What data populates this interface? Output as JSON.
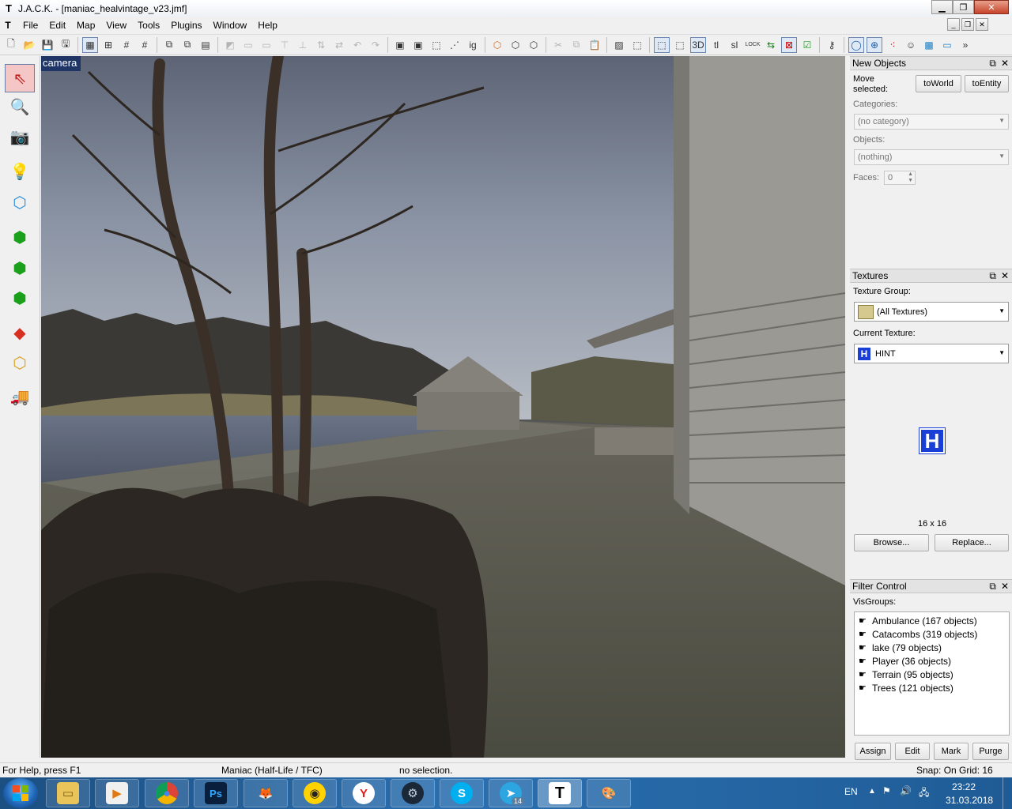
{
  "window": {
    "title": "J.A.C.K. - [maniac_healvintage_v23.jmf]",
    "minimize": "▁",
    "maximize": "❐",
    "close": "✕"
  },
  "menu": [
    "File",
    "Edit",
    "Map",
    "View",
    "Tools",
    "Plugins",
    "Window",
    "Help"
  ],
  "viewport": {
    "label": "camera"
  },
  "panels": {
    "new_objects": {
      "title": "New Objects",
      "move_selected": "Move selected:",
      "to_world": "toWorld",
      "to_entity": "toEntity",
      "categories_label": "Categories:",
      "categories_value": "(no category)",
      "objects_label": "Objects:",
      "objects_value": "(nothing)",
      "faces_label": "Faces:",
      "faces_value": "0"
    },
    "textures": {
      "title": "Textures",
      "group_label": "Texture Group:",
      "group_value": "(All Textures)",
      "current_label": "Current Texture:",
      "current_value": "HINT",
      "preview_letter": "H",
      "size": "16 x 16",
      "browse": "Browse...",
      "replace": "Replace..."
    },
    "filter": {
      "title": "Filter Control",
      "visgroups_label": "VisGroups:",
      "visgroups": [
        "Ambulance (167 objects)",
        "Catacombs (319 objects)",
        "lake (79 objects)",
        "Player (36 objects)",
        "Terrain (95 objects)",
        "Trees (121 objects)"
      ],
      "assign": "Assign",
      "edit": "Edit",
      "mark": "Mark",
      "purge": "Purge"
    }
  },
  "status": {
    "help": "For Help, press F1",
    "game": "Maniac (Half-Life / TFC)",
    "selection": "no selection.",
    "snap": "Snap: On Grid: 16"
  },
  "taskbar": {
    "language": "EN",
    "time": "23:22",
    "date": "31.03.2018",
    "telegram_badge": "14"
  }
}
